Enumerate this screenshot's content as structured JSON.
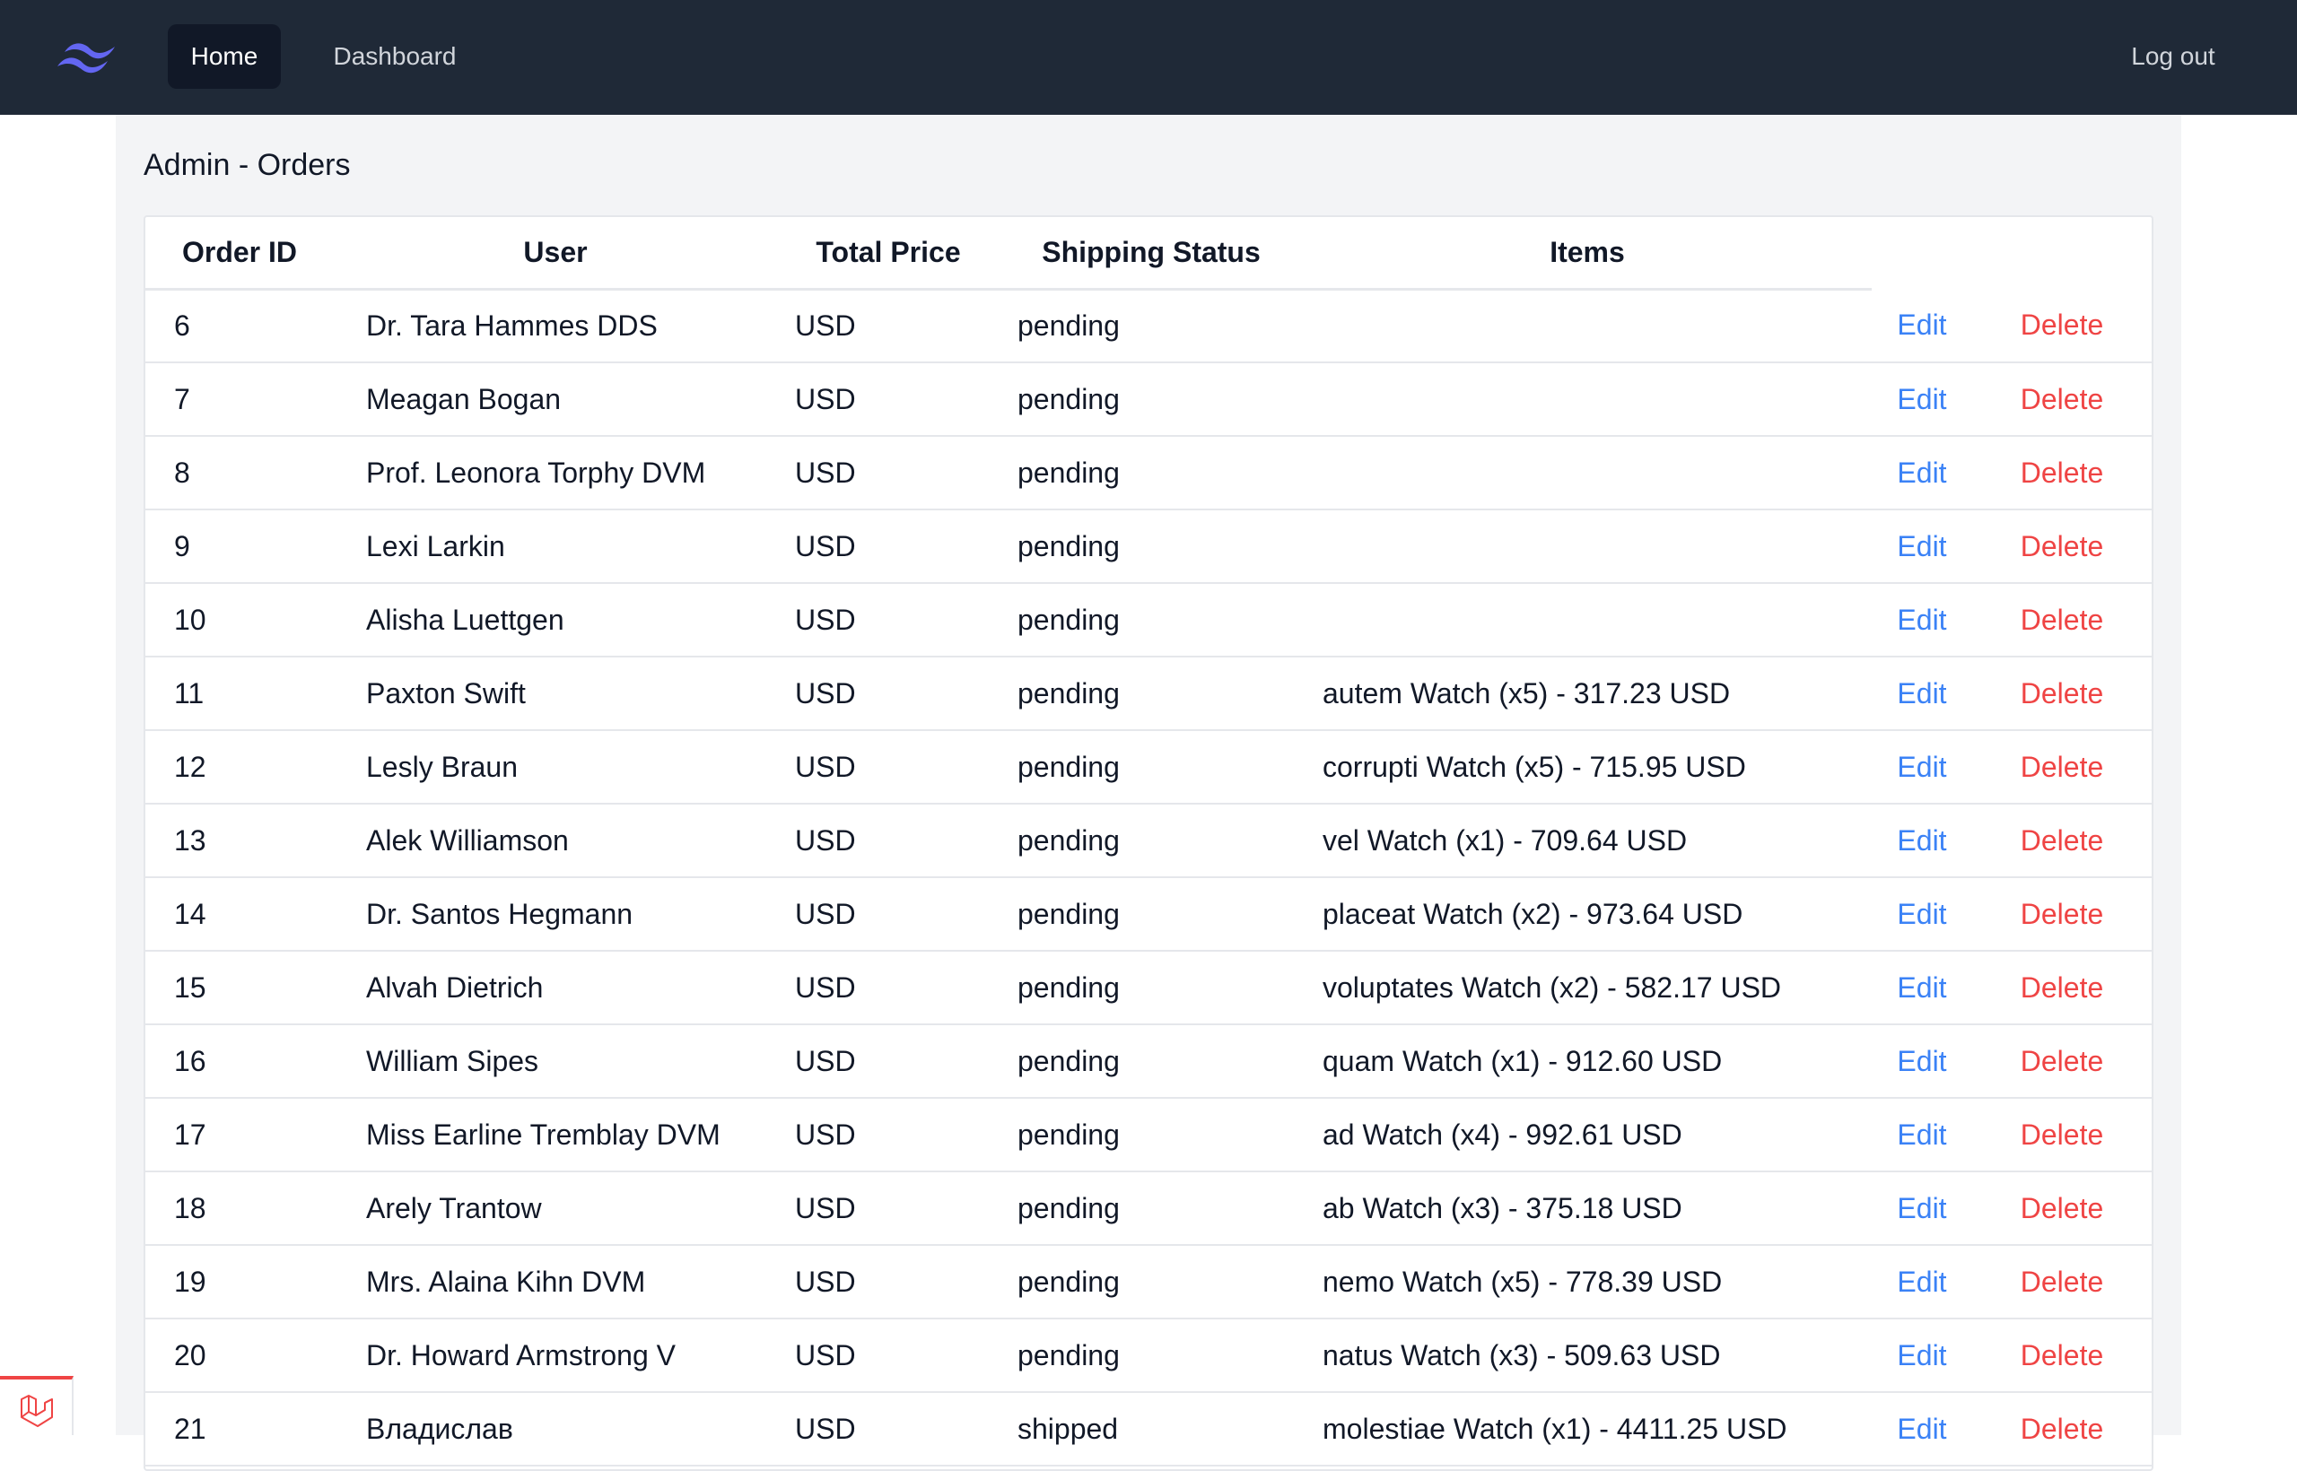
{
  "nav": {
    "home_label": "Home",
    "dashboard_label": "Dashboard",
    "logout_label": "Log out",
    "logo_icon": "tailwind-logo-icon",
    "accent_color": "#6366f1"
  },
  "page": {
    "title": "Admin - Orders"
  },
  "table": {
    "headers": [
      "Order ID",
      "User",
      "Total Price",
      "Shipping Status",
      "Items",
      "",
      ""
    ],
    "edit_label": "Edit",
    "delete_label": "Delete",
    "rows": [
      {
        "id": "6",
        "user": "Dr. Tara Hammes DDS",
        "price": "USD",
        "status": "pending",
        "items": ""
      },
      {
        "id": "7",
        "user": "Meagan Bogan",
        "price": "USD",
        "status": "pending",
        "items": ""
      },
      {
        "id": "8",
        "user": "Prof. Leonora Torphy DVM",
        "price": "USD",
        "status": "pending",
        "items": ""
      },
      {
        "id": "9",
        "user": "Lexi Larkin",
        "price": "USD",
        "status": "pending",
        "items": ""
      },
      {
        "id": "10",
        "user": "Alisha Luettgen",
        "price": "USD",
        "status": "pending",
        "items": ""
      },
      {
        "id": "11",
        "user": "Paxton Swift",
        "price": "USD",
        "status": "pending",
        "items": "autem Watch (x5) - 317.23 USD"
      },
      {
        "id": "12",
        "user": "Lesly Braun",
        "price": "USD",
        "status": "pending",
        "items": "corrupti Watch (x5) - 715.95 USD"
      },
      {
        "id": "13",
        "user": "Alek Williamson",
        "price": "USD",
        "status": "pending",
        "items": "vel Watch (x1) - 709.64 USD"
      },
      {
        "id": "14",
        "user": "Dr. Santos Hegmann",
        "price": "USD",
        "status": "pending",
        "items": "placeat Watch (x2) - 973.64 USD"
      },
      {
        "id": "15",
        "user": "Alvah Dietrich",
        "price": "USD",
        "status": "pending",
        "items": "voluptates Watch (x2) - 582.17 USD"
      },
      {
        "id": "16",
        "user": "William Sipes",
        "price": "USD",
        "status": "pending",
        "items": "quam Watch (x1) - 912.60 USD"
      },
      {
        "id": "17",
        "user": "Miss Earline Tremblay DVM",
        "price": "USD",
        "status": "pending",
        "items": "ad Watch (x4) - 992.61 USD"
      },
      {
        "id": "18",
        "user": "Arely Trantow",
        "price": "USD",
        "status": "pending",
        "items": "ab Watch (x3) - 375.18 USD"
      },
      {
        "id": "19",
        "user": "Mrs. Alaina Kihn DVM",
        "price": "USD",
        "status": "pending",
        "items": "nemo Watch (x5) - 778.39 USD"
      },
      {
        "id": "20",
        "user": "Dr. Howard Armstrong V",
        "price": "USD",
        "status": "pending",
        "items": "natus Watch (x3) - 509.63 USD"
      },
      {
        "id": "21",
        "user": "Владислав",
        "price": "USD",
        "status": "shipped",
        "items": "molestiae Watch (x1) - 4411.25 USD"
      }
    ]
  },
  "badge": {
    "icon": "laravel-logo-icon"
  }
}
